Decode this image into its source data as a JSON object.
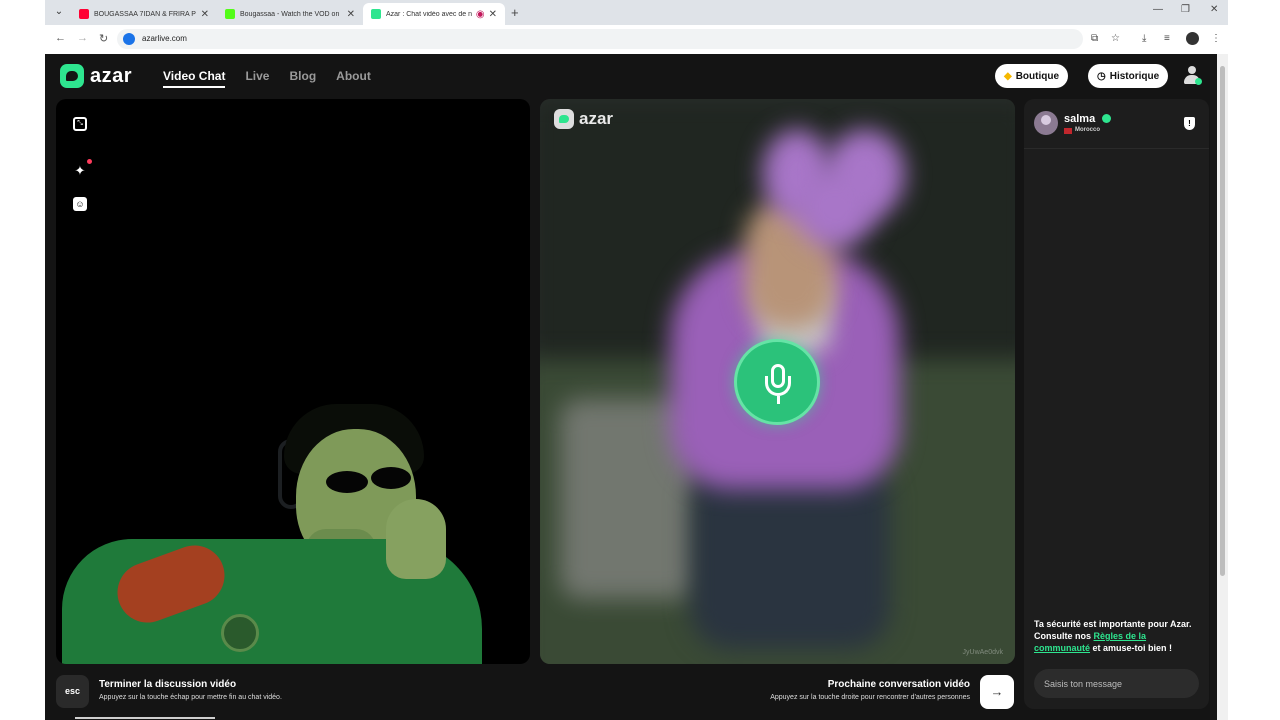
{
  "browser": {
    "tabs": [
      {
        "label": "BOUGASSAA 7IDAN & FRIRA P",
        "favicon_color": "#ff0033"
      },
      {
        "label": "Bougassaa - Watch the VOD on",
        "favicon_color": "#53fc18"
      },
      {
        "label": "Azar : Chat vidéo avec de n",
        "favicon_color": "#2ee58f"
      }
    ],
    "url": "azarlive.com"
  },
  "site": {
    "logo": "azar",
    "nav": [
      "Video Chat",
      "Live",
      "Blog",
      "About"
    ],
    "boutique_label": "Boutique",
    "historique_label": "Historique"
  },
  "remote_video": {
    "logo": "azar",
    "watermark": "JyUwAe0dvk"
  },
  "chat": {
    "username": "salma",
    "country": "Morocco",
    "safety_text_1": "Ta sécurité est importante pour Azar. Consulte nos ",
    "safety_link": "Règles de la communauté",
    "safety_text_2": " et amuse-toi bien !",
    "input_placeholder": "Saisis ton message"
  },
  "footer": {
    "esc_key": "esc",
    "end_title": "Terminer la discussion vidéo",
    "end_sub": "Appuyez sur la touche échap pour mettre fin au chat vidéo.",
    "next_title": "Prochaine conversation vidéo",
    "next_sub": "Appuyez sur la touche droite pour rencontrer d'autres personnes"
  },
  "colors": {
    "accent": "#2ee58f",
    "page_bg": "#141414",
    "panel_bg": "#1d1d1d"
  }
}
